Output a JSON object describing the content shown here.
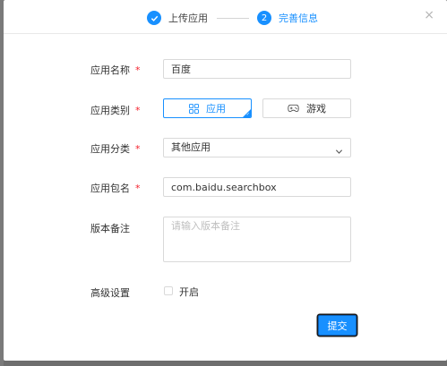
{
  "steps": [
    {
      "label": "上传应用",
      "status": "done"
    },
    {
      "label": "完善信息",
      "number": "2",
      "status": "current"
    }
  ],
  "close_glyph": "×",
  "form": {
    "app_name": {
      "label": "应用名称",
      "required_mark": "*",
      "value": "百度"
    },
    "app_type": {
      "label": "应用类别",
      "required_mark": "*",
      "options": [
        {
          "label": "应用",
          "icon": "apps-grid-icon",
          "selected": true
        },
        {
          "label": "游戏",
          "icon": "gamepad-icon",
          "selected": false
        }
      ]
    },
    "app_category": {
      "label": "应用分类",
      "required_mark": "*",
      "value": "其他应用"
    },
    "package_name": {
      "label": "应用包名",
      "required_mark": "*",
      "value": "com.baidu.searchbox"
    },
    "version_note": {
      "label": "版本备注",
      "placeholder": "请输入版本备注",
      "value": ""
    },
    "advanced": {
      "label": "高级设置",
      "checkbox_label": "开启",
      "checked": false
    }
  },
  "submit_label": "提交",
  "colors": {
    "primary": "#1890ff",
    "required": "#f5222d",
    "border": "#d9d9d9",
    "backdrop": "#6e6e6e"
  }
}
